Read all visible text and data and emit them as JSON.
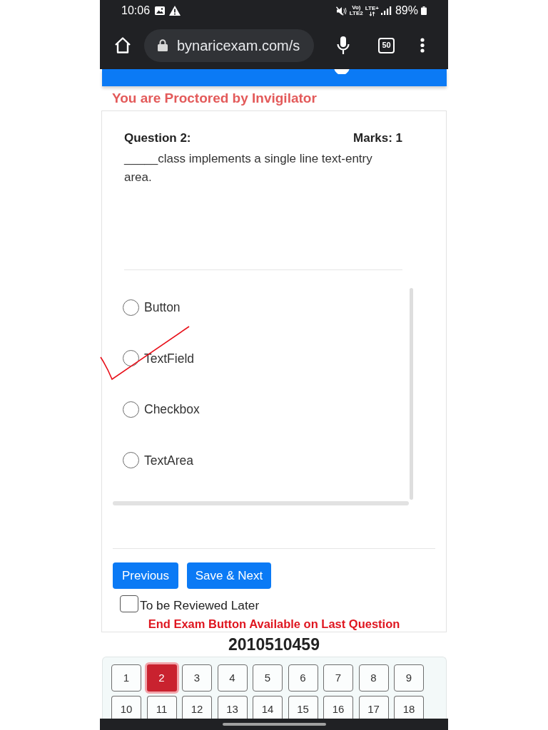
{
  "status_bar": {
    "time": "10:06",
    "volte": {
      "top": "Vo)",
      "bottom": "LTE2"
    },
    "data_type": "LTE+",
    "battery": "89%"
  },
  "browser": {
    "url": "bynaricexam.com/s",
    "tab_count": "50"
  },
  "proctor_notice": "You are Proctored by Invigilator",
  "question": {
    "title": "Question 2:",
    "marks": "Marks: 1",
    "text": "_____class implements a single line text-entry area."
  },
  "options": [
    {
      "label": "Button",
      "selected": false,
      "marked": false
    },
    {
      "label": "TextField",
      "selected": false,
      "marked": true
    },
    {
      "label": "Checkbox",
      "selected": false,
      "marked": false
    },
    {
      "label": "TextArea",
      "selected": false,
      "marked": false
    }
  ],
  "buttons": [
    {
      "label": "Previous"
    },
    {
      "label": "Save & Next"
    }
  ],
  "review": {
    "label": "To be Reviewed Later",
    "checked": false
  },
  "end_exam_notice": "End Exam Button Available on Last Question",
  "student_id": "2010510459",
  "palette": [
    {
      "label": "1",
      "selected": false
    },
    {
      "label": "2",
      "selected": true
    },
    {
      "label": "3",
      "selected": false
    },
    {
      "label": "4",
      "selected": false
    },
    {
      "label": "5",
      "selected": false
    },
    {
      "label": "6",
      "selected": false
    },
    {
      "label": "7",
      "selected": false
    },
    {
      "label": "8",
      "selected": false
    },
    {
      "label": "9",
      "selected": false
    },
    {
      "label": "10",
      "selected": false
    },
    {
      "label": "11",
      "selected": false
    },
    {
      "label": "12",
      "selected": false
    },
    {
      "label": "13",
      "selected": false
    },
    {
      "label": "14",
      "selected": false
    },
    {
      "label": "15",
      "selected": false
    },
    {
      "label": "16",
      "selected": false
    },
    {
      "label": "17",
      "selected": false
    },
    {
      "label": "18",
      "selected": false
    }
  ]
}
